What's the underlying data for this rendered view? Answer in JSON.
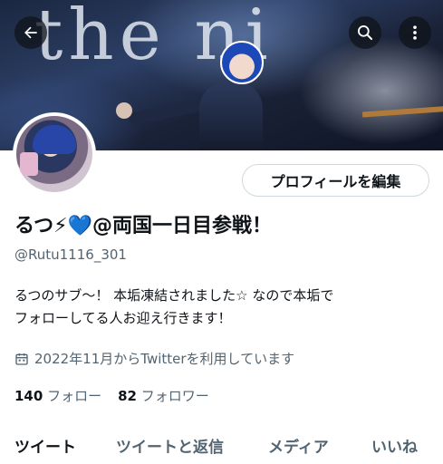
{
  "banner": {
    "text": "the ni"
  },
  "header": {
    "back_icon": "arrow-left-icon",
    "search_icon": "search-icon",
    "more_icon": "more-vertical-icon"
  },
  "profile": {
    "edit_button_label": "プロフィールを編集",
    "display_name": "るつ⚡💙@両国一日目参戦！",
    "handle": "@Rutu1116_301",
    "bio_lines": [
      "るつのサブ〜！ 本垢凍結されました☆ なので本垢で",
      "フォローしてる人お迎え行きます！"
    ],
    "joined": "2022年11月からTwitterを利用しています",
    "following_count": "140",
    "following_label": "フォロー",
    "followers_count": "82",
    "followers_label": "フォロワー"
  },
  "tabs": [
    {
      "label": "ツイート",
      "active": true
    },
    {
      "label": "ツイートと返信",
      "active": false
    },
    {
      "label": "メディア",
      "active": false
    },
    {
      "label": "いいね",
      "active": false
    }
  ],
  "colors": {
    "text_primary": "#0f1419",
    "text_secondary": "#536471",
    "border": "#cfd9de"
  }
}
